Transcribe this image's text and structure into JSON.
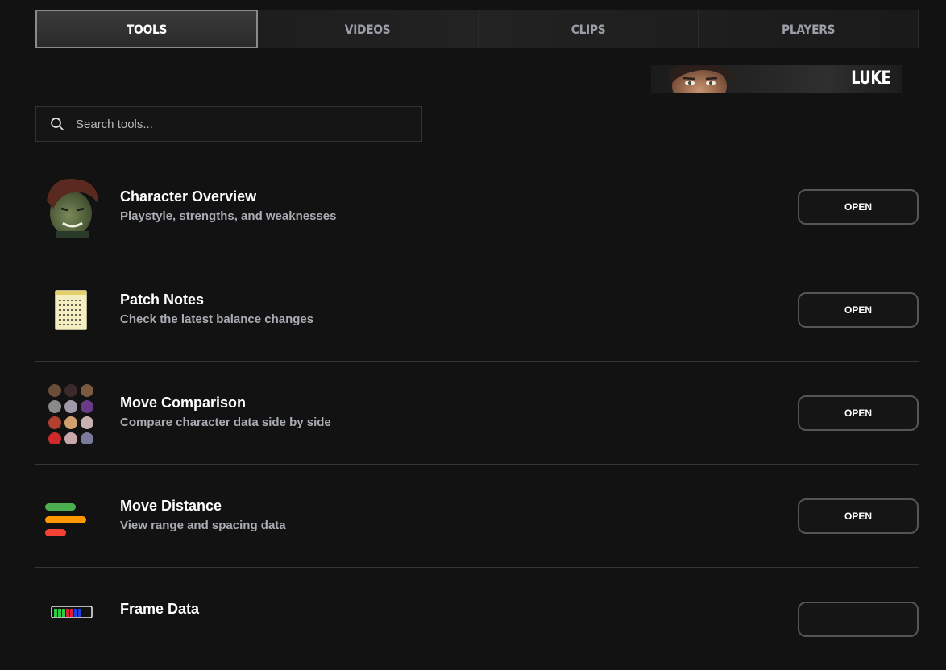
{
  "tabs": [
    {
      "label": "TOOLS",
      "active": true
    },
    {
      "label": "VIDEOS",
      "active": false
    },
    {
      "label": "CLIPS",
      "active": false
    },
    {
      "label": "PLAYERS",
      "active": false
    }
  ],
  "character": {
    "name": "LUKE"
  },
  "search": {
    "placeholder": "Search tools..."
  },
  "tools": [
    {
      "title": "Character Overview",
      "subtitle": "Playstyle, strengths, and weaknesses",
      "button": "OPEN",
      "icon": "character-portrait-icon"
    },
    {
      "title": "Patch Notes",
      "subtitle": "Check the latest balance changes",
      "button": "OPEN",
      "icon": "notepad-icon"
    },
    {
      "title": "Move Comparison",
      "subtitle": "Compare character data side by side",
      "button": "OPEN",
      "icon": "character-grid-icon"
    },
    {
      "title": "Move Distance",
      "subtitle": "View range and spacing data",
      "button": "OPEN",
      "icon": "distance-bars-icon"
    },
    {
      "title": "Frame Data",
      "subtitle": "",
      "button": "",
      "icon": "frame-data-icon"
    }
  ],
  "colors": {
    "background": "#121212",
    "distance_green": "#4caf50",
    "distance_orange": "#ff9800",
    "distance_red": "#f44336"
  }
}
